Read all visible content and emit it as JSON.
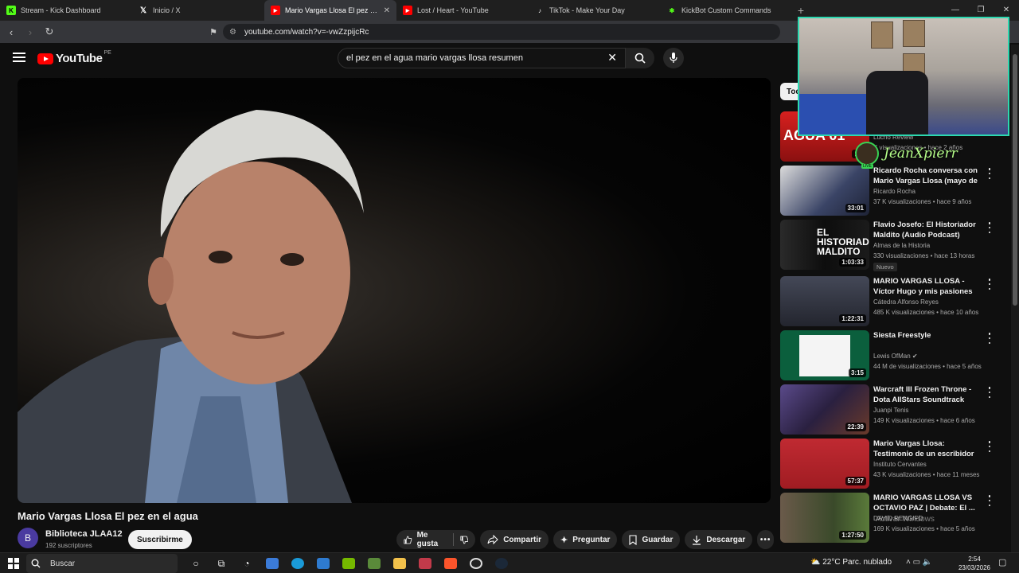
{
  "browser": {
    "tabs": [
      {
        "title": "Stream - Kick Dashboard",
        "active": false,
        "favicon": "kick-icon",
        "color": "#53fc18"
      },
      {
        "title": "Inicio / X",
        "active": false,
        "favicon": "x-icon",
        "color": "#ffffff"
      },
      {
        "title": "Mario Vargas Llosa El pez en el agua",
        "active": true,
        "favicon": "youtube-icon",
        "color": "#ff0000"
      },
      {
        "title": "Lost / Heart - YouTube",
        "active": false,
        "favicon": "youtube-icon",
        "color": "#ff0000"
      },
      {
        "title": "TikTok - Make Your Day",
        "active": false,
        "favicon": "tiktok-icon",
        "color": "#ffffff"
      },
      {
        "title": "KickBot Custom Commands",
        "active": false,
        "favicon": "kickbot-icon",
        "color": "#53fc18"
      }
    ],
    "url": "youtube.com/watch?v=-vwZzpijcRc"
  },
  "header": {
    "logo_text": "YouTube",
    "country_code": "PE",
    "search_value": "el pez en el agua mario vargas llosa resumen"
  },
  "video": {
    "title": "Mario Vargas Llosa El pez en el agua",
    "channel": "Biblioteca JLAA12",
    "avatar_letter": "B",
    "subscribers": "192 suscriptores",
    "subscribe_label": "Suscribirme",
    "actions": {
      "like": "Me gusta",
      "share": "Compartir",
      "ask": "Preguntar",
      "save": "Guardar",
      "download": "Descargar"
    }
  },
  "sidebar": {
    "chip": "Tod",
    "items": [
      {
        "title": "",
        "channel": "Lucho Review",
        "meta": "K visualizaciones • hace 2 años",
        "duration": "1:1",
        "thumb": "#b3141b"
      },
      {
        "title": "Ricardo Rocha conversa con Mario Vargas Llosa (mayo de ...",
        "channel": "Ricardo Rocha",
        "meta": "37 K visualizaciones • hace 9 años",
        "duration": "33:01",
        "thumb": "#2f3a56"
      },
      {
        "title": "Flavio Josefo: El Historiador Maldito (Audio Podcast)",
        "channel": "Almas de la Historia",
        "meta": "330 visualizaciones • hace 13 horas",
        "duration": "1:03:33",
        "thumb": "#1c1c1c",
        "badge": "Nuevo"
      },
      {
        "title": "MARIO VARGAS LLOSA - Víctor Hugo y mis pasiones literarias",
        "channel": "Cátedra Alfonso Reyes",
        "meta": "485 K visualizaciones • hace 10 años",
        "duration": "1:22:31",
        "thumb": "#3a3a44"
      },
      {
        "title": "Siesta Freestyle",
        "channel": "Lewis OfMan",
        "meta": "44 M de visualizaciones • hace 5 años",
        "duration": "3:15",
        "thumb": "#0c5a3a"
      },
      {
        "title": "Warcraft III Frozen Throne - Dota AllStars Soundtrack",
        "channel": "Juanpi Tenis",
        "meta": "149 K visualizaciones • hace 6 años",
        "duration": "22:39",
        "thumb": "#4a3c6a"
      },
      {
        "title": "Mario Vargas Llosa: Testimonio de un escribidor",
        "channel": "Instituto Cervantes",
        "meta": "43 K visualizaciones • hace 11 meses",
        "duration": "57:37",
        "thumb": "#c0343a"
      },
      {
        "title": "MARIO VARGAS LLOSA VS OCTAVIO PAZ | Debate: El ...",
        "channel": "DAVID RENGIFO",
        "meta": "169 K visualizaciones • hace 5 años",
        "duration": "1:27:50",
        "thumb": "#3a4a30"
      }
    ]
  },
  "stream_overlay": {
    "name": "JeanXpierr",
    "live": "LIVE"
  },
  "watermark": "Activar Windows",
  "taskbar": {
    "search_placeholder": "Buscar",
    "temperature": "22°C",
    "weather": "Parc. nublado",
    "time": "2:54",
    "date": "23/03/2026"
  }
}
